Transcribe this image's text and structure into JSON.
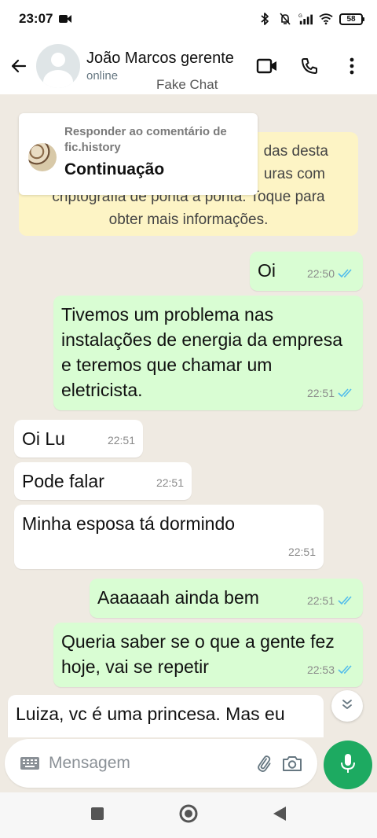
{
  "status_bar": {
    "time": "23:07",
    "battery": "58",
    "icons": [
      "screen-record-icon",
      "bluetooth-icon",
      "mute-icon",
      "signal-icon",
      "wifi-icon",
      "battery-icon"
    ]
  },
  "header": {
    "contact_name": "João Marcos gerente",
    "contact_status": "online",
    "overlay_label": "Fake Chat",
    "icons": [
      "back-arrow-icon",
      "video-call-icon",
      "voice-call-icon",
      "more-vertical-icon"
    ]
  },
  "reply_popup": {
    "subtitle": "Responder ao comentário de fic.history",
    "title": "Continuação"
  },
  "encryption_notice": {
    "lines": [
      "das desta",
      "uras com",
      "criptografia de ponta a ponta. Toque para",
      "obter mais informações."
    ]
  },
  "messages": [
    {
      "direction": "out",
      "text": "Oi",
      "time": "22:50",
      "read": true
    },
    {
      "direction": "out",
      "text": "Tivemos um problema nas instalações de energia da empresa e teremos que chamar um eletricista.",
      "time": "22:51",
      "read": true
    },
    {
      "direction": "in",
      "text": "Oi Lu",
      "time": "22:51"
    },
    {
      "direction": "in",
      "text": "Pode falar",
      "time": "22:51"
    },
    {
      "direction": "in",
      "text": "Minha esposa tá dormindo",
      "time": "22:51"
    },
    {
      "direction": "out",
      "text": "Aaaaaah ainda bem",
      "time": "22:51",
      "read": true
    },
    {
      "direction": "out",
      "text": "Queria saber se o que a gente fez hoje, vai se repetir",
      "time": "22:53",
      "read": true
    },
    {
      "direction": "in",
      "text": "Luiza, vc é uma princesa. Mas eu",
      "time": ""
    }
  ],
  "composer": {
    "placeholder": "Mensagem",
    "icons": [
      "keyboard-icon",
      "attach-icon",
      "camera-icon",
      "mic-icon"
    ]
  },
  "colors": {
    "chat_background": "#efeae2",
    "outgoing_bubble": "#d9fdd3",
    "incoming_bubble": "#ffffff",
    "read_ticks": "#53bdeb",
    "accent_green": "#1daa61",
    "notice_background": "#fdf4c5"
  }
}
